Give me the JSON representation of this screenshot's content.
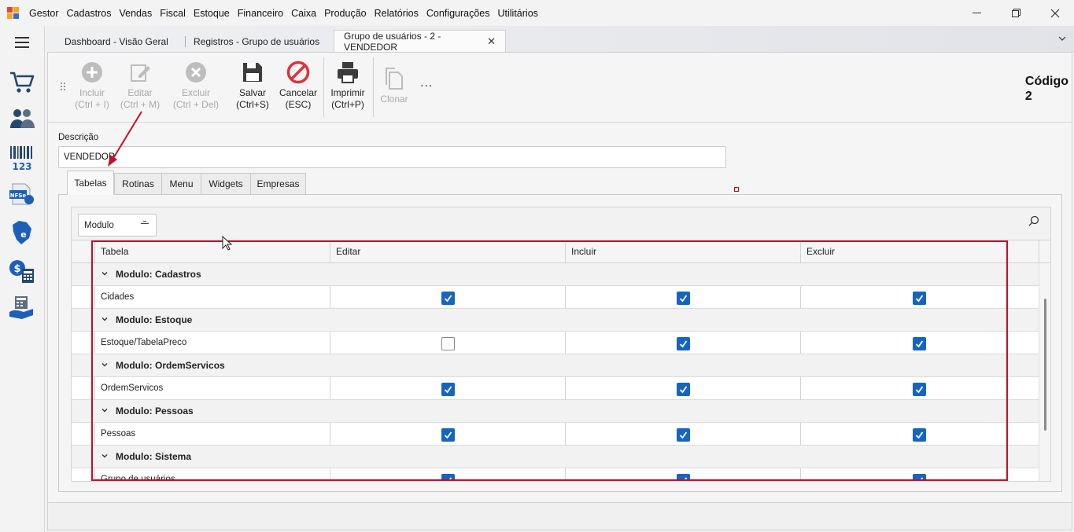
{
  "menubar": {
    "items": [
      "Gestor",
      "Cadastros",
      "Vendas",
      "Fiscal",
      "Estoque",
      "Financeiro",
      "Caixa",
      "Produção",
      "Relatórios",
      "Configurações",
      "Utilitários"
    ],
    "window_controls": {
      "minimize": "—",
      "maximize": "❐",
      "close": "✕"
    }
  },
  "rail": {
    "icons": [
      "menu-icon",
      "cart-icon",
      "people-icon",
      "barcode-icon",
      "nfse-icon",
      "nfe-icon",
      "finance-calculator-icon",
      "cash-register-icon"
    ]
  },
  "doc_tabs": [
    {
      "label": "Dashboard - Visão Geral",
      "active": false
    },
    {
      "label": "Registros - Grupo de usuários",
      "active": false
    },
    {
      "label": "Grupo de usuários - 2 - VENDEDOR",
      "active": true
    }
  ],
  "toolbar": {
    "incluir": {
      "line1": "Incluir",
      "line2": "(Ctrl + I)"
    },
    "editar": {
      "line1": "Editar",
      "line2": "(Ctrl + M)"
    },
    "excluir": {
      "line1": "Excluir",
      "line2": "(Ctrl + Del)"
    },
    "salvar": {
      "line1": "Salvar",
      "line2": "(Ctrl+S)"
    },
    "cancelar": {
      "line1": "Cancelar",
      "line2": "(ESC)"
    },
    "imprimir": {
      "line1": "Imprimir",
      "line2": "(Ctrl+P)"
    },
    "clonar": {
      "line1": "Clonar"
    },
    "more": "...",
    "codigo_label": "Código",
    "codigo_value": "2"
  },
  "form": {
    "descricao_label": "Descrição",
    "descricao_value": "VENDEDOR"
  },
  "subtabs": [
    "Tabelas",
    "Rotinas",
    "Menu",
    "Widgets",
    "Empresas"
  ],
  "grid": {
    "group_chip": "Modulo",
    "columns": [
      "Tabela",
      "Editar",
      "Incluir",
      "Excluir"
    ],
    "rows": [
      {
        "type": "group",
        "label": "Modulo: Cadastros"
      },
      {
        "type": "data",
        "tabela": "Cidades",
        "editar": true,
        "incluir": true,
        "excluir": true
      },
      {
        "type": "group",
        "label": "Modulo: Estoque"
      },
      {
        "type": "data",
        "tabela": "Estoque/TabelaPreco",
        "editar": false,
        "incluir": true,
        "excluir": true
      },
      {
        "type": "group",
        "label": "Modulo: OrdemServicos"
      },
      {
        "type": "data",
        "tabela": "OrdemServicos",
        "editar": true,
        "incluir": true,
        "excluir": true
      },
      {
        "type": "group",
        "label": "Modulo: Pessoas"
      },
      {
        "type": "data",
        "tabela": "Pessoas",
        "editar": true,
        "incluir": true,
        "excluir": true
      },
      {
        "type": "group",
        "label": "Modulo: Sistema"
      },
      {
        "type": "data",
        "tabela": "Grupo de usuários",
        "editar": true,
        "incluir": true,
        "excluir": true
      }
    ]
  },
  "colors": {
    "checkbox_on": "#1565c0",
    "annotation_red": "#c0102a",
    "cancel_red": "#d9343f"
  }
}
